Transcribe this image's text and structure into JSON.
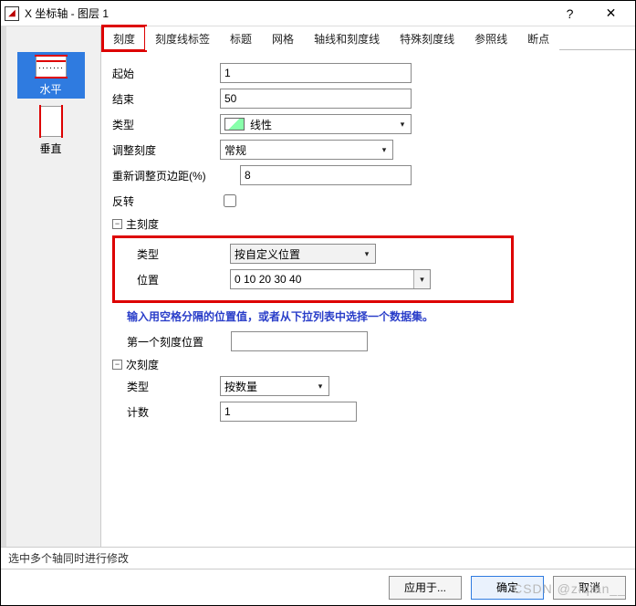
{
  "title": "X 坐标轴 - 图层 1",
  "titlebar": {
    "help": "?",
    "close": "✕"
  },
  "sidebar": {
    "items": [
      {
        "label": "水平"
      },
      {
        "label": "垂直"
      }
    ]
  },
  "tabs": [
    {
      "label": "刻度"
    },
    {
      "label": "刻度线标签"
    },
    {
      "label": "标题"
    },
    {
      "label": "网格"
    },
    {
      "label": "轴线和刻度线"
    },
    {
      "label": "特殊刻度线"
    },
    {
      "label": "参照线"
    },
    {
      "label": "断点"
    }
  ],
  "form": {
    "start": {
      "label": "起始",
      "value": "1"
    },
    "end": {
      "label": "结束",
      "value": "50"
    },
    "type": {
      "label": "类型",
      "value": "线性"
    },
    "rescale": {
      "label": "调整刻度",
      "value": "常规"
    },
    "rescale_margin": {
      "label": "重新调整页边距(%)",
      "value": "8"
    },
    "reverse": {
      "label": "反转"
    },
    "major": {
      "title": "主刻度",
      "type": {
        "label": "类型",
        "value": "按自定义位置"
      },
      "position": {
        "label": "位置",
        "value": "0 10 20 30 40"
      },
      "hint": "输入用空格分隔的位置值，或者从下拉列表中选择一个数据集。",
      "first": {
        "label": "第一个刻度位置",
        "value": ""
      }
    },
    "minor": {
      "title": "次刻度",
      "type": {
        "label": "类型",
        "value": "按数量"
      },
      "count": {
        "label": "计数",
        "value": "1"
      }
    }
  },
  "footer": "选中多个轴同时进行修改",
  "buttons": {
    "apply": "应用于...",
    "ok": "确定",
    "cancel": "取消"
  },
  "watermark": "CSDN @ziqian__"
}
